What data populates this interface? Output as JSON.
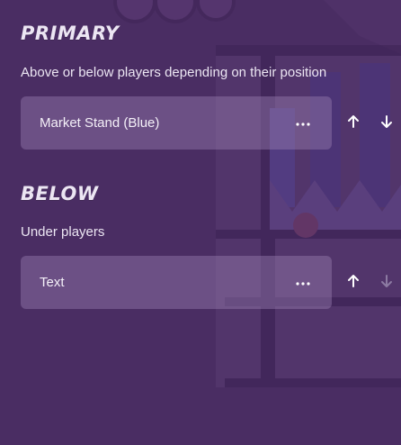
{
  "sections": [
    {
      "title": "PRIMARY",
      "description": "Above or below players depending on their position",
      "layers": [
        {
          "name": "Market Stand (Blue)",
          "up_enabled": true,
          "down_enabled": true
        }
      ]
    },
    {
      "title": "BELOW",
      "description": "Under players",
      "layers": [
        {
          "name": "Text",
          "up_enabled": true,
          "down_enabled": false
        }
      ]
    }
  ],
  "icons": {
    "more": "more-horizontal-icon",
    "up": "arrow-up-icon",
    "down": "arrow-down-icon"
  },
  "colors": {
    "background": "#4a2d63",
    "row": "#7a5f96",
    "text": "#ece6f3",
    "icon_enabled": "#ffffff",
    "icon_disabled": "#8c7aa2"
  }
}
